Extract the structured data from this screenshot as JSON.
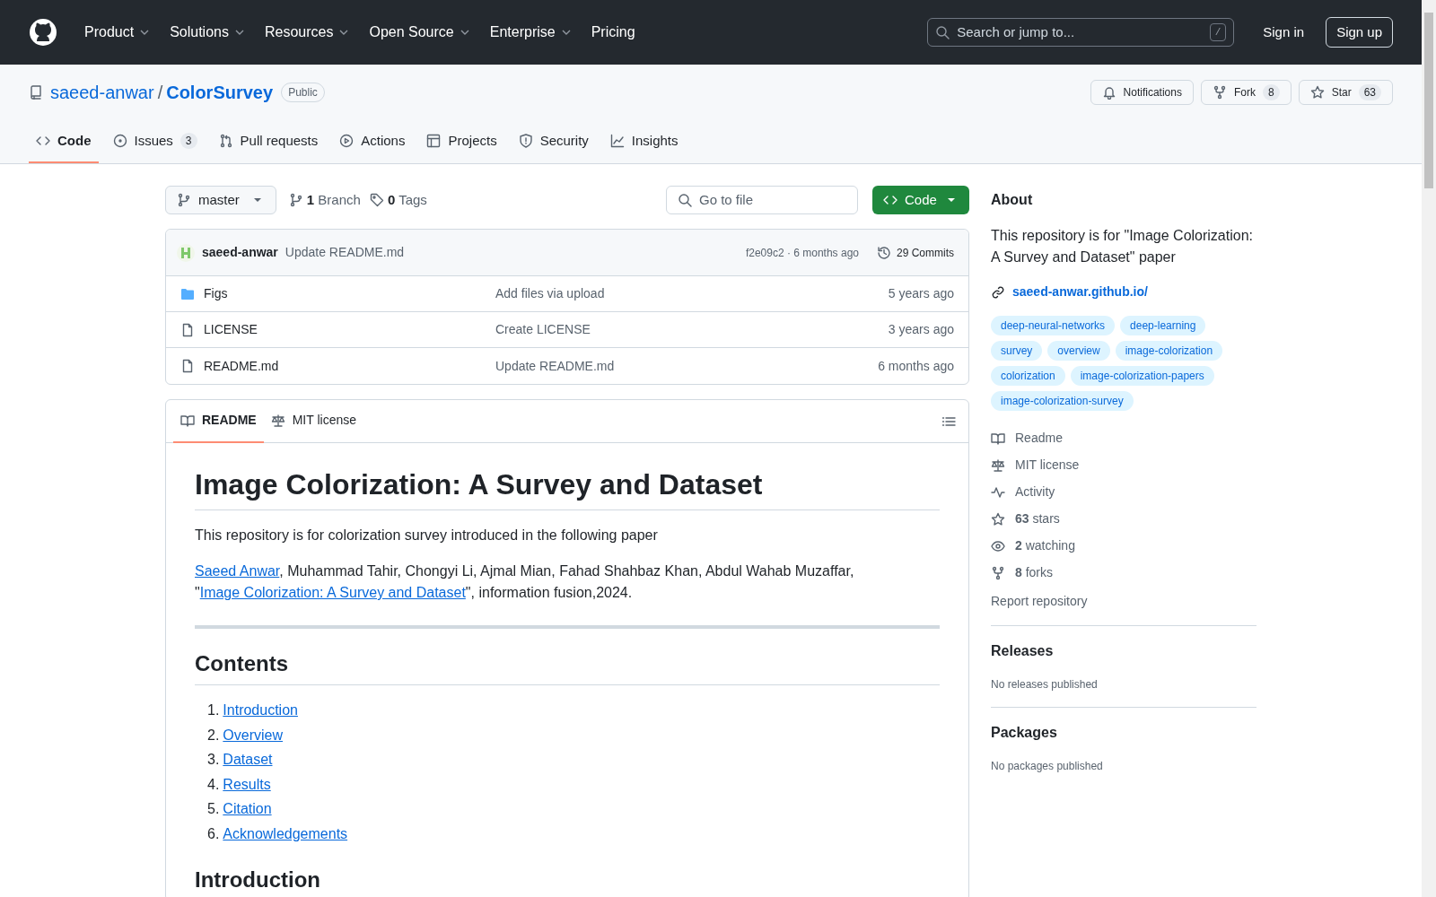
{
  "nav": {
    "items": [
      {
        "label": "Product",
        "dropdown": true
      },
      {
        "label": "Solutions",
        "dropdown": true
      },
      {
        "label": "Resources",
        "dropdown": true
      },
      {
        "label": "Open Source",
        "dropdown": true
      },
      {
        "label": "Enterprise",
        "dropdown": true
      },
      {
        "label": "Pricing",
        "dropdown": false
      }
    ],
    "search": {
      "placeholder": "Search or jump to...",
      "shortcut": "/"
    },
    "sign_in": "Sign in",
    "sign_up": "Sign up"
  },
  "repo": {
    "owner": "saeed-anwar",
    "separator": "/",
    "name": "ColorSurvey",
    "visibility": "Public",
    "actions": [
      {
        "kind": "notifications",
        "label": "Notifications"
      },
      {
        "kind": "fork",
        "label": "Fork",
        "count": "8"
      },
      {
        "kind": "star",
        "label": "Star",
        "count": "63"
      }
    ]
  },
  "tabs": [
    {
      "kind": "code",
      "label": "Code",
      "selected": true
    },
    {
      "kind": "issues",
      "label": "Issues",
      "count": "3",
      "selected": false
    },
    {
      "kind": "pulls",
      "label": "Pull requests",
      "selected": false
    },
    {
      "kind": "actions",
      "label": "Actions",
      "selected": false
    },
    {
      "kind": "projects",
      "label": "Projects",
      "selected": false
    },
    {
      "kind": "security",
      "label": "Security",
      "selected": false
    },
    {
      "kind": "insights",
      "label": "Insights",
      "selected": false
    }
  ],
  "toolbar": {
    "branch": "master",
    "branches": {
      "count": "1",
      "label": "Branch"
    },
    "tags": {
      "count": "0",
      "label": "Tags"
    },
    "go_to_file": {
      "placeholder": "Go to file"
    },
    "code_button": "Code"
  },
  "latest_commit": {
    "author": "saeed-anwar",
    "message": "Update README.md",
    "sha_time": "f2e09c2 · 6 months ago",
    "commits": "29 Commits"
  },
  "files": [
    {
      "kind": "folder",
      "name": "Figs",
      "message": "Add files via upload",
      "time": "5 years ago"
    },
    {
      "kind": "file",
      "name": "LICENSE",
      "message": "Create LICENSE",
      "time": "3 years ago"
    },
    {
      "kind": "file",
      "name": "README.md",
      "message": "Update README.md",
      "time": "6 months ago"
    }
  ],
  "readme": {
    "tabs": [
      {
        "kind": "readme",
        "label": "README",
        "selected": true
      },
      {
        "kind": "license",
        "label": "MIT license",
        "selected": false
      }
    ],
    "title": "Image Colorization: A Survey and Dataset",
    "intro": "This repository is for colorization survey introduced in the following paper",
    "authors": [
      {
        "text": "Saeed Anwar",
        "link": true
      },
      {
        "text": ", Muhammad Tahir, Chongyi Li, Ajmal Mian, Fahad Shahbaz Khan, Abdul Wahab Muzaffar, \"",
        "link": false
      },
      {
        "text": "Image Colorization: A Survey and Dataset",
        "link": true
      },
      {
        "text": "\", information fusion,2024.",
        "link": false
      }
    ],
    "contents_heading": "Contents",
    "contents": [
      {
        "number": "1.",
        "label": "Introduction"
      },
      {
        "number": "2.",
        "label": "Overview"
      },
      {
        "number": "3.",
        "label": "Dataset"
      },
      {
        "number": "4.",
        "label": "Results"
      },
      {
        "number": "5.",
        "label": "Citation"
      },
      {
        "number": "6.",
        "label": "Acknowledgements"
      }
    ],
    "next_heading": "Introduction"
  },
  "about": {
    "heading": "About",
    "description": "This repository is for \"Image Colorization: A Survey and Dataset\" paper",
    "website": "saeed-anwar.github.io/",
    "topics": [
      "deep-neural-networks",
      "deep-learning",
      "survey",
      "overview",
      "image-colorization",
      "colorization",
      "image-colorization-papers",
      "image-colorization-survey"
    ],
    "stats": [
      {
        "kind": "readme",
        "label": "Readme"
      },
      {
        "kind": "license",
        "label": "MIT license"
      },
      {
        "kind": "activity",
        "label": "Activity"
      },
      {
        "kind": "stars",
        "count": "63",
        "label": "stars"
      },
      {
        "kind": "watching",
        "count": "2",
        "label": "watching"
      },
      {
        "kind": "forks",
        "count": "8",
        "label": "forks"
      }
    ],
    "report": "Report repository"
  },
  "releases": {
    "heading": "Releases",
    "note": "No releases published"
  },
  "packages": {
    "heading": "Packages",
    "note": "No packages published"
  }
}
